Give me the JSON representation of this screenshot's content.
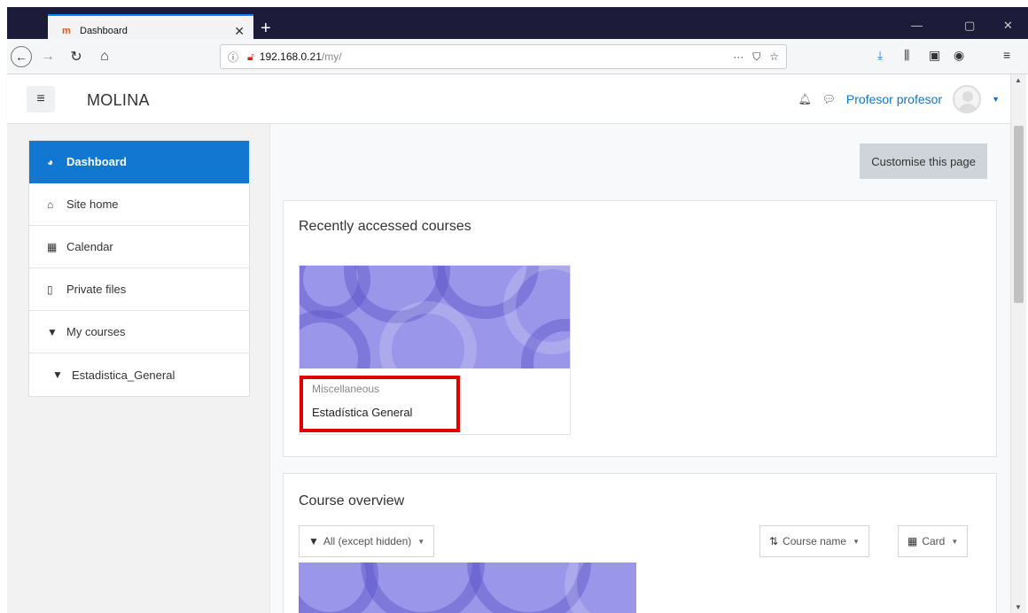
{
  "browser": {
    "tab_title": "Dashboard",
    "url_host": "192.168.0.21",
    "url_path": "/my/",
    "url_actions": [
      "···",
      "⛉",
      "☆"
    ]
  },
  "header": {
    "brand": "MOLINA",
    "user_name": "Profesor profesor"
  },
  "sidebar": {
    "items": [
      {
        "label": "Dashboard",
        "icon": "dashboard-icon"
      },
      {
        "label": "Site home",
        "icon": "home-icon"
      },
      {
        "label": "Calendar",
        "icon": "calendar-icon"
      },
      {
        "label": "Private files",
        "icon": "file-icon"
      },
      {
        "label": "My courses",
        "icon": "graduation-cap-icon"
      },
      {
        "label": "Estadistica_General",
        "icon": "graduation-cap-icon"
      }
    ]
  },
  "main": {
    "customise_label": "Customise this page",
    "recent": {
      "title": "Recently accessed courses",
      "course_category": "Miscellaneous",
      "course_name": "Estadística General"
    },
    "overview": {
      "title": "Course overview",
      "filter_label": "All (except hidden)",
      "sort_label": "Course name",
      "view_label": "Card"
    }
  },
  "colors": {
    "accent": "#1177d1",
    "highlight": "#e00000",
    "course_image": "#9a96ea"
  }
}
